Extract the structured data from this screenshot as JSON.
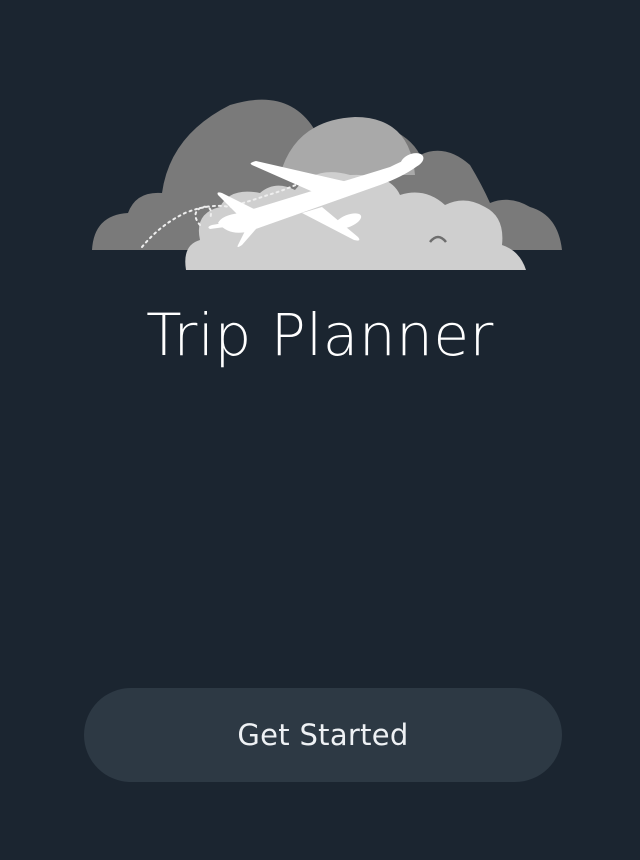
{
  "app": {
    "title": "Trip Planner"
  },
  "hero": {
    "icon": "airplane-over-clouds-icon"
  },
  "actions": {
    "get_started_label": "Get Started"
  },
  "colors": {
    "background": "#1b2530",
    "button_background": "#2d3944",
    "title_text": "#ffffff",
    "cloud_dark": "#7a7a7a",
    "cloud_mid": "#a9a9a9",
    "cloud_light": "#cfcfcf",
    "plane": "#ffffff"
  }
}
